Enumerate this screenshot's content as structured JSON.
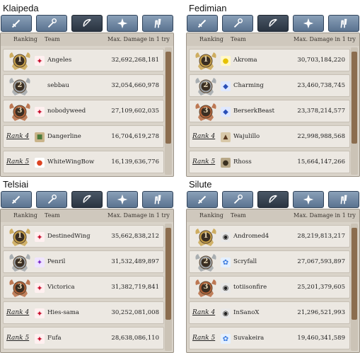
{
  "headers": {
    "ranking": "Ranking",
    "team": "Team",
    "damage": "Max. Damage in 1 try"
  },
  "colors": {
    "gold": "#c9a24a",
    "silver": "#9ea3a8",
    "bronze": "#b5643a",
    "tab": "#6a829c",
    "tab_active": "#334050"
  },
  "servers": [
    {
      "name": "Klaipeda",
      "rows": [
        {
          "rank": "1",
          "rank_label": "",
          "emblem": "red-bird",
          "team": "Angeles",
          "damage": "32,692,268,181"
        },
        {
          "rank": "2",
          "rank_label": "",
          "emblem": "none",
          "team": "sebbau",
          "damage": "32,054,660,978"
        },
        {
          "rank": "3",
          "rank_label": "",
          "emblem": "red-bird",
          "team": "nobodyweed",
          "damage": "27,109,602,035"
        },
        {
          "rank": "4",
          "rank_label": "Rank 4",
          "emblem": "picture",
          "team": "Dangerline",
          "damage": "16,704,619,278"
        },
        {
          "rank": "5",
          "rank_label": "Rank 5",
          "emblem": "mushroom",
          "team": "WhiteWingBow",
          "damage": "16,139,636,776"
        }
      ]
    },
    {
      "name": "Fedimian",
      "rows": [
        {
          "rank": "1",
          "rank_label": "",
          "emblem": "chick",
          "team": "Akroma",
          "damage": "30,703,184,220"
        },
        {
          "rank": "2",
          "rank_label": "",
          "emblem": "blue-shield",
          "team": "Charming",
          "damage": "23,460,738,745"
        },
        {
          "rank": "3",
          "rank_label": "",
          "emblem": "blue-shield",
          "team": "BerserkBeast",
          "damage": "23,378,214,577"
        },
        {
          "rank": "4",
          "rank_label": "Rank 4",
          "emblem": "warrior",
          "team": "Wajulillo",
          "damage": "22,998,988,568"
        },
        {
          "rank": "5",
          "rank_label": "Rank 5",
          "emblem": "round-dark",
          "team": "Rhoss",
          "damage": "15,664,147,266"
        }
      ]
    },
    {
      "name": "Telsiai",
      "rows": [
        {
          "rank": "1",
          "rank_label": "",
          "emblem": "red-bird",
          "team": "DestinedWing",
          "damage": "35,662,838,212"
        },
        {
          "rank": "2",
          "rank_label": "",
          "emblem": "purple-dragon",
          "team": "Penril",
          "damage": "31,532,489,897"
        },
        {
          "rank": "3",
          "rank_label": "",
          "emblem": "red-bird",
          "team": "Victorica",
          "damage": "31,382,719,841"
        },
        {
          "rank": "4",
          "rank_label": "Rank 4",
          "emblem": "red-bird",
          "team": "Hies-sama",
          "damage": "30,252,081,008"
        },
        {
          "rank": "5",
          "rank_label": "Rank 5",
          "emblem": "red-bird",
          "team": "Fufa",
          "damage": "28,638,086,110"
        }
      ]
    },
    {
      "name": "Silute",
      "rows": [
        {
          "rank": "1",
          "rank_label": "",
          "emblem": "dark-shape",
          "team": "Andromed4",
          "damage": "28,219,813,217"
        },
        {
          "rank": "2",
          "rank_label": "",
          "emblem": "blue-wisp",
          "team": "Scryfall",
          "damage": "27,067,593,897"
        },
        {
          "rank": "3",
          "rank_label": "",
          "emblem": "dark-shape",
          "team": "totiisonfire",
          "damage": "25,201,379,605"
        },
        {
          "rank": "4",
          "rank_label": "Rank 4",
          "emblem": "dark-shape",
          "team": "InSanoX",
          "damage": "21,296,521,993"
        },
        {
          "rank": "5",
          "rank_label": "Rank 5",
          "emblem": "blue-wisp",
          "team": "Suvakeira",
          "damage": "19,460,341,589"
        }
      ]
    }
  ],
  "tabs": [
    {
      "icon": "sword-icon"
    },
    {
      "icon": "staff-icon"
    },
    {
      "icon": "bow-icon"
    },
    {
      "icon": "cross-icon"
    },
    {
      "icon": "hands-icon"
    }
  ]
}
